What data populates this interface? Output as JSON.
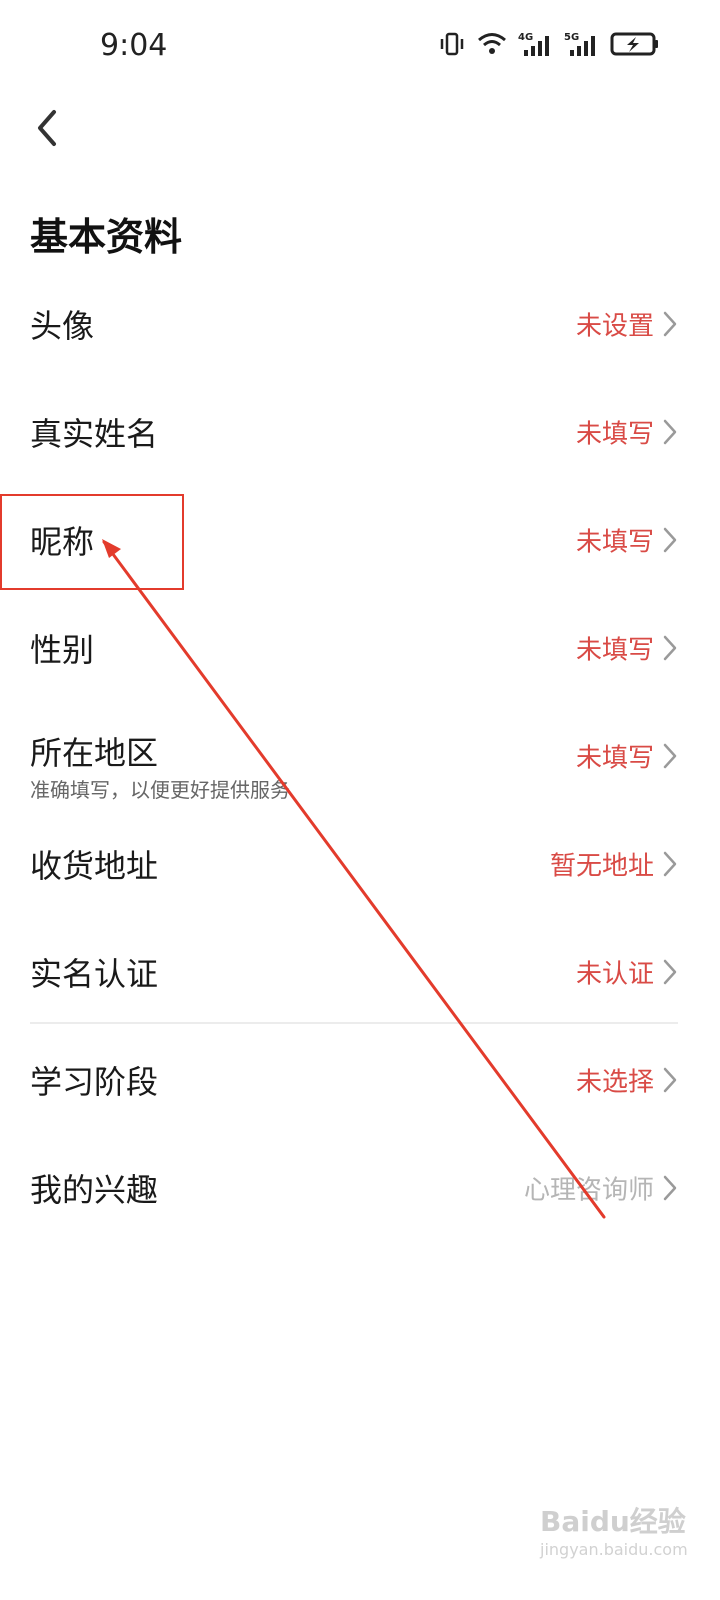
{
  "status_bar": {
    "time": "9:04",
    "net1": "4G",
    "net2": "5G"
  },
  "page": {
    "title": "基本资料"
  },
  "rows": [
    {
      "label": "头像",
      "value": "未设置"
    },
    {
      "label": "真实姓名",
      "value": "未填写"
    },
    {
      "label": "昵称",
      "value": "未填写"
    },
    {
      "label": "性别",
      "value": "未填写"
    },
    {
      "label": "所在地区",
      "sub": "准确填写，以便更好提供服务",
      "value": "未填写"
    },
    {
      "label": "收货地址",
      "value": "暂无地址"
    },
    {
      "label": "实名认证",
      "value": "未认证"
    },
    {
      "label": "学习阶段",
      "value": "未选择"
    },
    {
      "label": "我的兴趣",
      "value": "心理咨询师"
    }
  ],
  "watermark": {
    "brand": "Baidu经验",
    "url": "jingyan.baidu.com"
  },
  "colors": {
    "value_red": "#d94b46",
    "muted": "#b5b5b5",
    "annotation_red": "#e33b2c"
  }
}
